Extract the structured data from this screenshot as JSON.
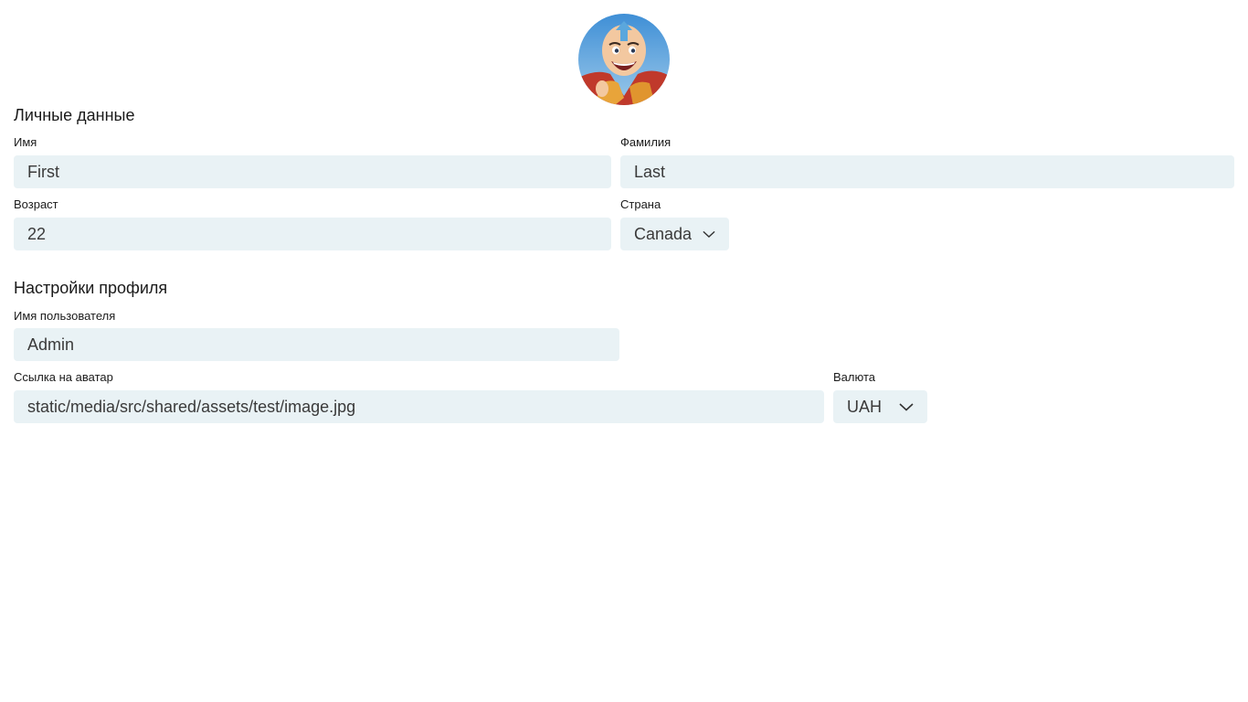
{
  "avatar": {
    "alt": "avatar"
  },
  "personal": {
    "title": "Личные данные",
    "first_name": {
      "label": "Имя",
      "value": "First"
    },
    "last_name": {
      "label": "Фамилия",
      "value": "Last"
    },
    "age": {
      "label": "Возраст",
      "value": "22"
    },
    "country": {
      "label": "Страна",
      "value": "Canada"
    }
  },
  "profile": {
    "title": "Настройки профиля",
    "username": {
      "label": "Имя пользователя",
      "value": "Admin"
    },
    "avatar_link": {
      "label": "Ссылка на аватар",
      "value": "static/media/src/shared/assets/test/image.jpg"
    },
    "currency": {
      "label": "Валюта",
      "value": "UAH"
    }
  },
  "colors": {
    "field_bg": "#e9f2f5",
    "text": "#1a1a1a"
  },
  "icons": {
    "select_arrow": "chevron-down-icon"
  }
}
